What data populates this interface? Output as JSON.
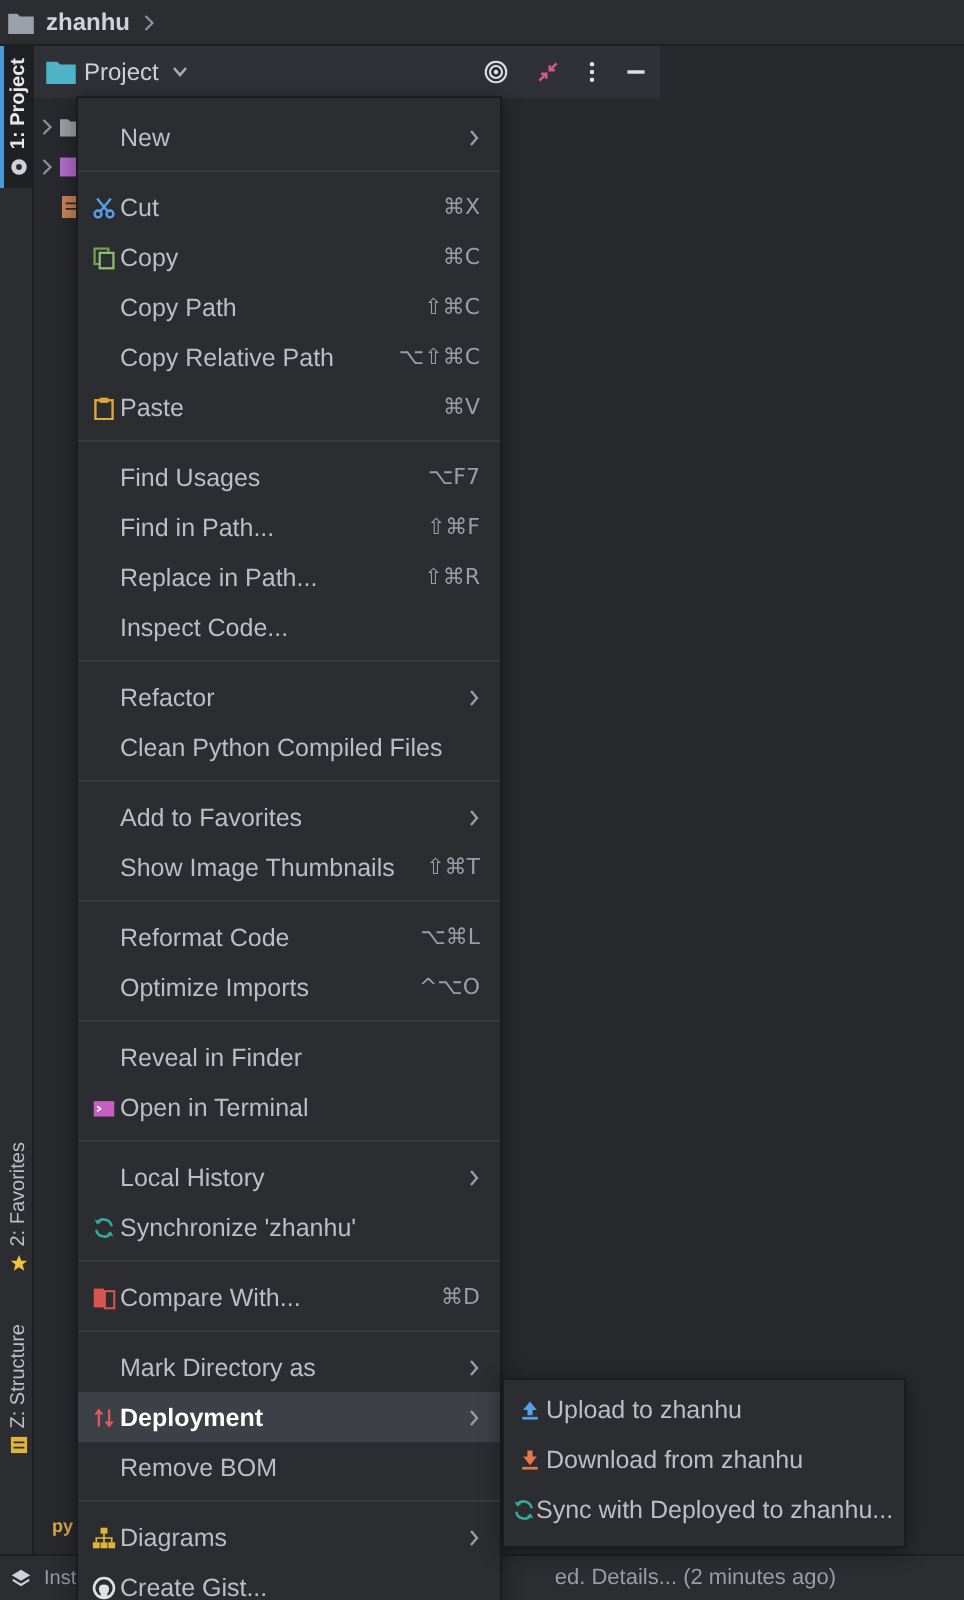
{
  "breadcrumb": {
    "label": "zhanhu"
  },
  "tool_windows": [
    {
      "label": "1: Project",
      "selected": true
    },
    {
      "label": "2: Favorites",
      "selected": false
    },
    {
      "label": "Z: Structure",
      "selected": false
    }
  ],
  "project_panel": {
    "title": "Project"
  },
  "background_fragments": {
    "file_badge": "py",
    "status_left": "Inst",
    "status_right": "ed. Details... (2 minutes ago)"
  },
  "context_menu": {
    "groups": [
      [
        {
          "label": "New",
          "has_submenu": true,
          "selected": false
        }
      ],
      [
        {
          "label": "Cut",
          "shortcut": "⌘X",
          "has_submenu": false,
          "selected": false
        },
        {
          "label": "Copy",
          "shortcut": "⌘C",
          "has_submenu": false,
          "selected": false
        },
        {
          "label": "Copy Path",
          "shortcut": "⇧⌘C",
          "has_submenu": false,
          "selected": false
        },
        {
          "label": "Copy Relative Path",
          "shortcut": "⌥⇧⌘C",
          "has_submenu": false,
          "selected": false
        },
        {
          "label": "Paste",
          "shortcut": "⌘V",
          "has_submenu": false,
          "selected": false
        }
      ],
      [
        {
          "label": "Find Usages",
          "shortcut": "⌥F7",
          "has_submenu": false,
          "selected": false
        },
        {
          "label": "Find in Path...",
          "shortcut": "⇧⌘F",
          "has_submenu": false,
          "selected": false
        },
        {
          "label": "Replace in Path...",
          "shortcut": "⇧⌘R",
          "has_submenu": false,
          "selected": false
        },
        {
          "label": "Inspect Code...",
          "has_submenu": false,
          "selected": false
        }
      ],
      [
        {
          "label": "Refactor",
          "has_submenu": true,
          "selected": false
        },
        {
          "label": "Clean Python Compiled Files",
          "has_submenu": false,
          "selected": false
        }
      ],
      [
        {
          "label": "Add to Favorites",
          "has_submenu": true,
          "selected": false
        },
        {
          "label": "Show Image Thumbnails",
          "shortcut": "⇧⌘T",
          "has_submenu": false,
          "selected": false
        }
      ],
      [
        {
          "label": "Reformat Code",
          "shortcut": "⌥⌘L",
          "has_submenu": false,
          "selected": false
        },
        {
          "label": "Optimize Imports",
          "shortcut": "^⌥O",
          "has_submenu": false,
          "selected": false
        }
      ],
      [
        {
          "label": "Reveal in Finder",
          "has_submenu": false,
          "selected": false
        },
        {
          "label": "Open in Terminal",
          "has_submenu": false,
          "selected": false
        }
      ],
      [
        {
          "label": "Local History",
          "has_submenu": true,
          "selected": false
        },
        {
          "label": "Synchronize 'zhanhu'",
          "has_submenu": false,
          "selected": false
        }
      ],
      [
        {
          "label": "Compare With...",
          "shortcut": "⌘D",
          "has_submenu": false,
          "selected": false
        }
      ],
      [
        {
          "label": "Mark Directory as",
          "has_submenu": true,
          "selected": false
        },
        {
          "label": "Deployment",
          "has_submenu": true,
          "selected": true
        },
        {
          "label": "Remove BOM",
          "has_submenu": false,
          "selected": false
        }
      ],
      [
        {
          "label": "Diagrams",
          "has_submenu": true,
          "selected": false
        },
        {
          "label": "Create Gist...",
          "has_submenu": false,
          "selected": false
        }
      ]
    ]
  },
  "submenu": {
    "items": [
      {
        "label": "Upload to zhanhu",
        "selected": false
      },
      {
        "label": "Download from zhanhu",
        "selected": false
      },
      {
        "label": "Sync with Deployed to zhanhu...",
        "selected": false
      }
    ]
  }
}
